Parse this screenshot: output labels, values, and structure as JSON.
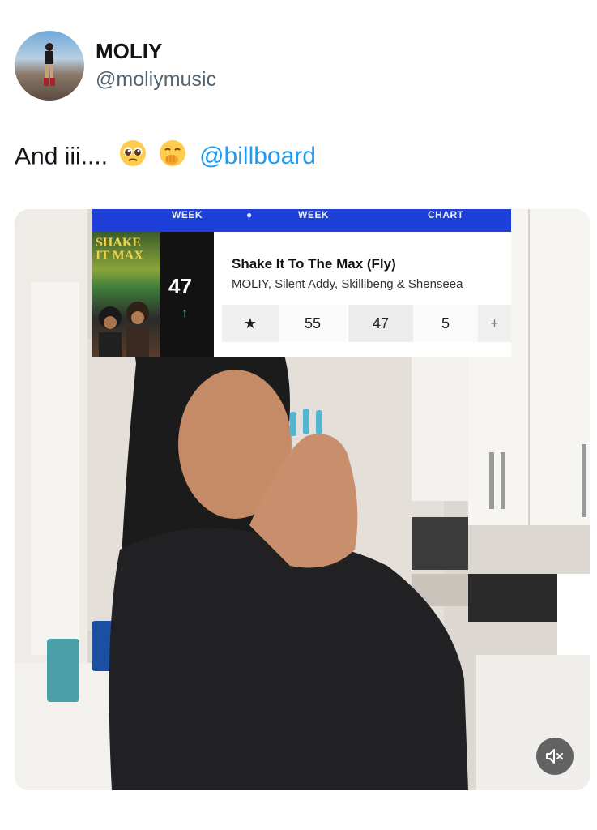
{
  "author": {
    "display_name": "MOLIY",
    "handle": "@moliymusic"
  },
  "tweet": {
    "text_prefix": "And iii....",
    "emojis": [
      "pleading-face-emoji",
      "face-with-hand-over-mouth-emoji"
    ],
    "mention": "@billboard"
  },
  "chart_card": {
    "header_labels": [
      "WEEK",
      "WEEK",
      "CHART"
    ],
    "rank": "47",
    "movement": "↑",
    "song_title": "Shake It To The Max (Fly)",
    "artists": "MOLIY, Silent Addy, Skillibeng & Shenseea",
    "stats": [
      "★",
      "55",
      "47",
      "5",
      "+"
    ],
    "art_text": "SHAKE IT MAX"
  },
  "media": {
    "mute_icon": "volume-muted-icon"
  },
  "colors": {
    "mention": "#1d9bf0",
    "billboard_blue": "#1e40d8",
    "rank_bg": "#121212",
    "up_arrow": "#22c07a"
  }
}
